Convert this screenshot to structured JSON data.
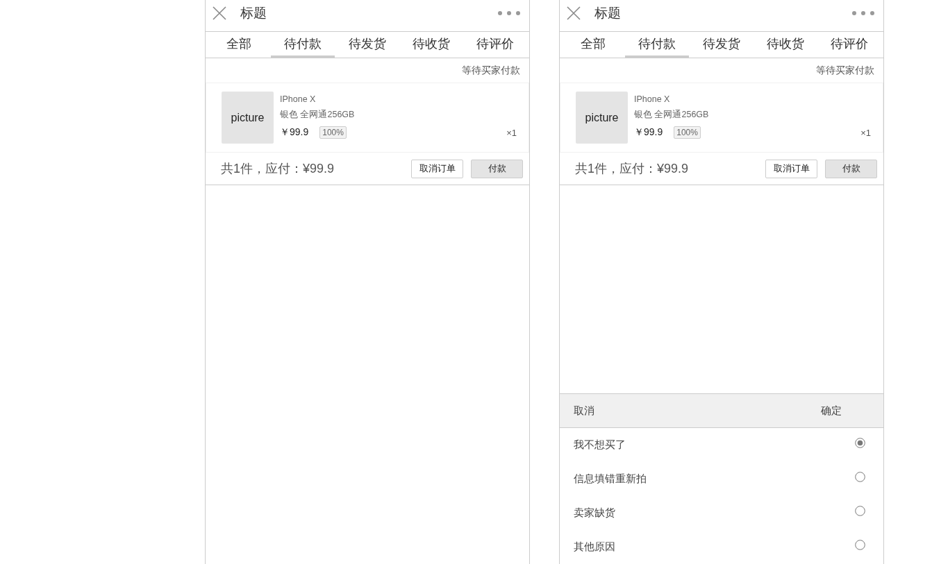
{
  "screens": [
    {
      "title": "标题",
      "tabs": [
        {
          "label": "全部",
          "selected": false
        },
        {
          "label": "待付款",
          "selected": true
        },
        {
          "label": "待发货",
          "selected": false
        },
        {
          "label": "待收货",
          "selected": false
        },
        {
          "label": "待评价",
          "selected": false
        }
      ],
      "status": "等待买家付款",
      "item": {
        "picture": "picture",
        "name": "IPhone X",
        "spec": "银色 全网通256GB",
        "price": "￥99.9",
        "tag": "100%",
        "quantity": "×1"
      },
      "summary": "共1件，应付：¥99.9",
      "buttons": [
        {
          "label": "取消订单",
          "kind": "outline"
        },
        {
          "label": "付款",
          "kind": "filled"
        }
      ]
    },
    {
      "title": "标题",
      "tabs": [
        {
          "label": "全部",
          "selected": false
        },
        {
          "label": "待付款",
          "selected": true
        },
        {
          "label": "待发货",
          "selected": false
        },
        {
          "label": "待收货",
          "selected": false
        },
        {
          "label": "待评价",
          "selected": false
        }
      ],
      "status": "等待买家付款",
      "item": {
        "picture": "picture",
        "name": "IPhone X",
        "spec": "银色 全网通256GB",
        "price": "￥99.9",
        "tag": "100%",
        "quantity": "×1"
      },
      "summary": "共1件，应付：¥99.9",
      "buttons": [
        {
          "label": "取消订单",
          "kind": "outline"
        },
        {
          "label": "付款",
          "kind": "filled"
        }
      ],
      "sheet": {
        "cancel": "取消",
        "confirm": "确定",
        "options": [
          {
            "label": "我不想买了",
            "selected": true
          },
          {
            "label": "信息填错重新拍",
            "selected": false
          },
          {
            "label": "卖家缺货",
            "selected": false
          },
          {
            "label": "其他原因",
            "selected": false
          }
        ]
      }
    }
  ]
}
